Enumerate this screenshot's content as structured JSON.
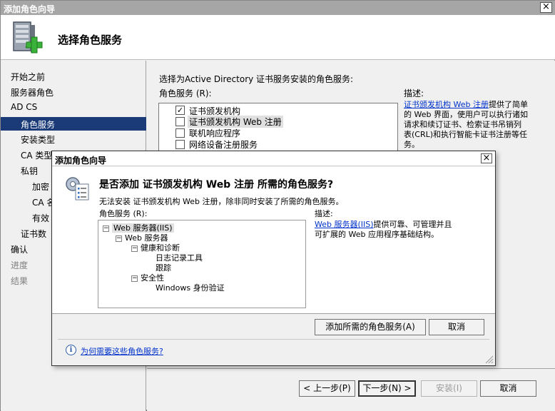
{
  "window": {
    "title": "添加角色向导",
    "close_glyph": "×"
  },
  "header": {
    "title": "选择角色服务",
    "icon": "server-add-icon"
  },
  "nav": {
    "items": [
      {
        "label": "开始之前",
        "state": "normal"
      },
      {
        "label": "服务器角色",
        "state": "normal"
      },
      {
        "label": "AD CS",
        "state": "normal"
      },
      {
        "label": "角色服务",
        "state": "selected"
      },
      {
        "label": "安装类型",
        "state": "normal"
      },
      {
        "label": "CA 类型",
        "state": "normal"
      },
      {
        "label": "私钥",
        "state": "normal"
      },
      {
        "label": "加密",
        "state": "normal"
      },
      {
        "label": "CA 名",
        "state": "normal"
      },
      {
        "label": "有效",
        "state": "normal"
      },
      {
        "label": "证书数",
        "state": "normal"
      },
      {
        "label": "确认",
        "state": "normal"
      },
      {
        "label": "进度",
        "state": "disabled"
      },
      {
        "label": "结果",
        "state": "disabled"
      }
    ]
  },
  "main": {
    "instruction": "选择为Active Directory 证书服务安装的角色服务:",
    "list_label": "角色服务 (R):",
    "services": [
      {
        "label": "证书颁发机构",
        "checked": true,
        "check_glyph": "✓"
      },
      {
        "label": "证书颁发机构 Web 注册",
        "checked": false,
        "check_glyph": ""
      },
      {
        "label": "联机响应程序",
        "checked": false,
        "check_glyph": ""
      },
      {
        "label": "网络设备注册服务",
        "checked": false,
        "check_glyph": ""
      }
    ],
    "desc_label": "描述:",
    "desc_link": "证书颁发机构 Web 注册",
    "desc_text_1": "提供了简单",
    "desc_text_2": "的 Web 界面，使用户可以执行诸如",
    "desc_text_3": "请求和续订证书、检索证书吊销列",
    "desc_text_4": "表(CRL)和执行智能卡证书注册等任",
    "desc_text_5": "务。"
  },
  "footer": {
    "prev": "< 上一步(P)",
    "next": "下一步(N) >",
    "install": "安装(I)",
    "cancel": "取消"
  },
  "dialog": {
    "title": "添加角色向导",
    "close_glyph": "×",
    "question": "是否添加 证书颁发机构 Web 注册 所需的角色服务?",
    "explain": "无法安装 证书颁发机构 Web 注册，除非同时安装了所需的角色服务。",
    "tree_label": "角色服务 (R):",
    "tree": [
      {
        "label": "Web 服务器(IIS)",
        "expander": "−",
        "level": 0,
        "highlight": true
      },
      {
        "label": "Web 服务器",
        "expander": "−",
        "level": 1,
        "highlight": false
      },
      {
        "label": "健康和诊断",
        "expander": "−",
        "level": 2,
        "highlight": false
      },
      {
        "label": "日志记录工具",
        "expander": "",
        "level": 3,
        "highlight": false
      },
      {
        "label": "跟踪",
        "expander": "",
        "level": 3,
        "highlight": false
      },
      {
        "label": "安全性",
        "expander": "−",
        "level": 2,
        "highlight": false
      },
      {
        "label": "Windows 身份验证",
        "expander": "",
        "level": 3,
        "highlight": false
      }
    ],
    "desc_label": "描述:",
    "desc_link": "Web 服务器(IIS)",
    "desc_text_1": "提供可靠、可管理并且",
    "desc_text_2": "可扩展的 Web 应用程序基础结构。",
    "add_button": "添加所需的角色服务(A)",
    "cancel_button": "取消",
    "help_link": "为何需要这些角色服务?",
    "info_glyph": "i"
  }
}
